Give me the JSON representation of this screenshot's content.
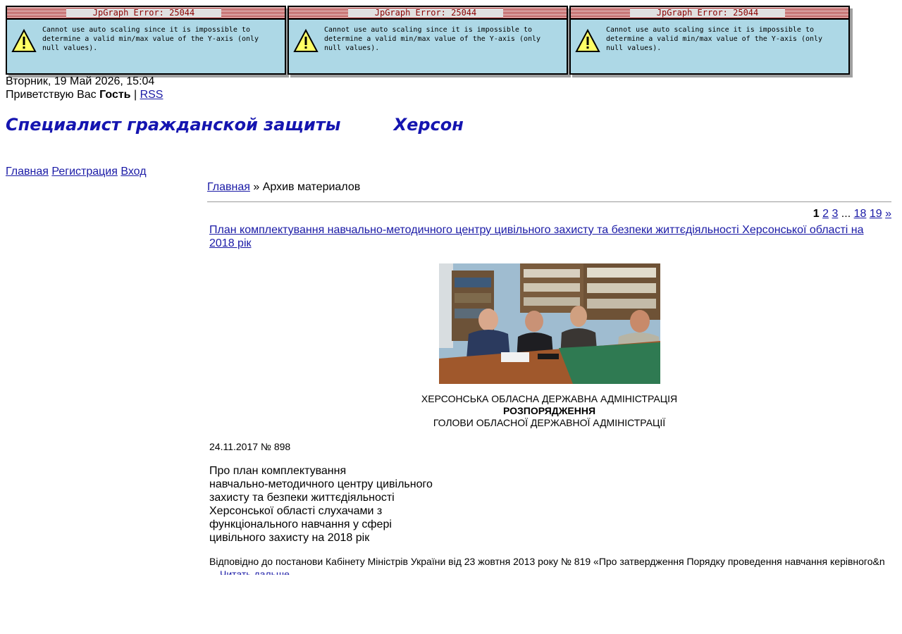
{
  "errors": [
    {
      "title": "JpGraph Error: 25044",
      "message": "Cannot use auto scaling since it is impossible to determine a valid min/max value of the Y-axis (only null values)."
    },
    {
      "title": "JpGraph Error: 25044",
      "message": "Cannot use auto scaling since it is impossible to determine a valid min/max value of the Y-axis (only null values)."
    },
    {
      "title": "JpGraph Error: 25044",
      "message": "Cannot use auto scaling since it is impossible to determine a valid min/max value of the Y-axis (only null values)."
    }
  ],
  "header": {
    "date": "Вторник, 19 Май 2026, 15:04",
    "greeting_prefix": "Приветствую Вас ",
    "user": "Гость",
    "separator": " | ",
    "rss": "RSS",
    "site_title": "Специалист гражданской защиты         Херсон"
  },
  "nav": {
    "home": "Главная",
    "register": "Регистрация",
    "login": "Вход"
  },
  "breadcrumb": {
    "home": "Главная",
    "sep": " » ",
    "current": "Архив материалов"
  },
  "pager": {
    "current": "1",
    "p2": "2",
    "p3": "3",
    "ellipsis": " ... ",
    "p18": "18",
    "p19": "19",
    "next": "»"
  },
  "entry": {
    "title": "План комплектування навчально-методичного центру цивільного захисту та безпеки життєдіяльності Херсонської області на 2018 рік",
    "doc_line1": "ХЕРСОНСЬКА ОБЛАСНА ДЕРЖАВНА АДМІНІСТРАЦІЯ",
    "doc_line2": "РОЗПОРЯДЖЕННЯ",
    "doc_line3": "ГОЛОВИ ОБЛАСНОЇ ДЕРЖАВНОЇ АДМІНІСТРАЦІЇ",
    "doc_date": "24.11.2017 № 898",
    "subject": [
      "Про план комплектування",
      "навчально-методичного центру цивільного",
      "захисту та безпеки життєдіяльності",
      "Херсонської області слухачами з",
      "функціонального навчання у сфері",
      "цивільного захисту на 2018 рік"
    ],
    "body": "Відповідно до постанови Кабінету Міністрів України від 23 жовтня 2013 року № 819 «Про затвердження Порядку проведення навчання керівного&n",
    "read_more": "Читать дальше"
  },
  "colors": {
    "link": "#1a1aa6",
    "title": "#1515b0",
    "error_bg": "#add8e6",
    "error_title": "#8b0000"
  }
}
